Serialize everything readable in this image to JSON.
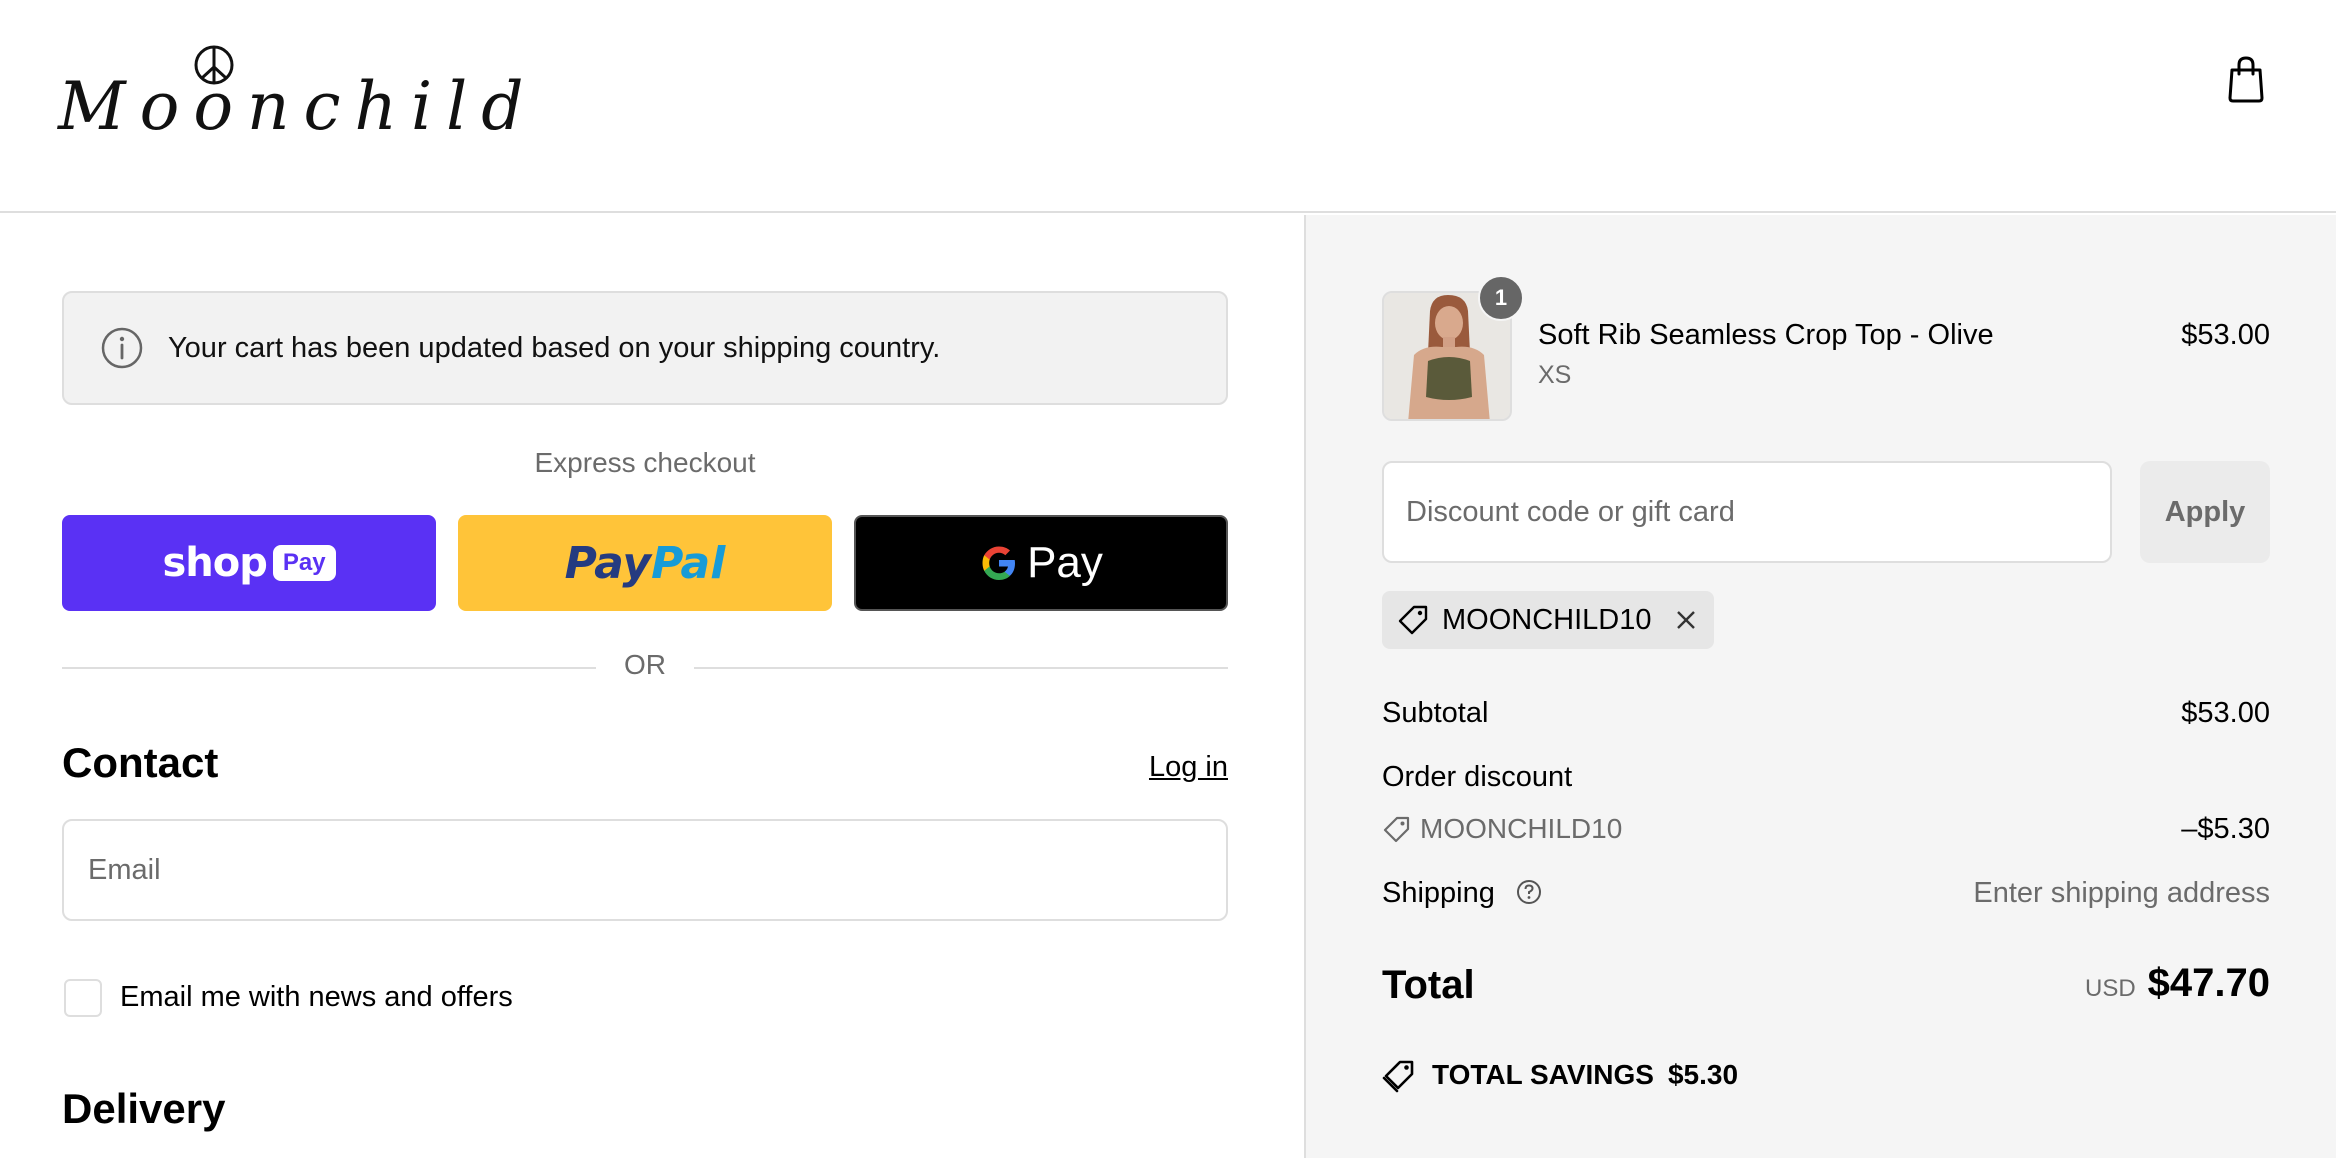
{
  "brand": {
    "name": "Moonchild",
    "logo_icon": "peace-sign-icon"
  },
  "header": {
    "cart_icon": "shopping-bag-icon"
  },
  "notice": {
    "icon": "info-icon",
    "text": "Your cart has been updated based on your shipping country."
  },
  "express": {
    "label": "Express checkout",
    "buttons": [
      {
        "name": "Shop Pay",
        "word": "shop",
        "pill": "Pay",
        "color": "#5a31f4"
      },
      {
        "name": "PayPal",
        "part1": "Pay",
        "part2": "Pal",
        "color": "#ffc439"
      },
      {
        "name": "Google Pay",
        "text": "Pay",
        "color": "#000000"
      }
    ],
    "or": "OR"
  },
  "contact": {
    "title": "Contact",
    "login": "Log in",
    "email_placeholder": "Email",
    "newsletter_label": "Email me with news and offers"
  },
  "delivery": {
    "title": "Delivery"
  },
  "order": {
    "item": {
      "name": "Soft Rib Seamless Crop Top - Olive",
      "variant": "XS",
      "price": "$53.00",
      "quantity": "1"
    },
    "discount_placeholder": "Discount code or gift card",
    "apply_label": "Apply",
    "applied_code": "MOONCHILD10",
    "subtotal_label": "Subtotal",
    "subtotal_value": "$53.00",
    "order_discount_label": "Order discount",
    "discount_code": "MOONCHILD10",
    "discount_value": "–$5.30",
    "shipping_label": "Shipping",
    "shipping_value": "Enter shipping address",
    "total_label": "Total",
    "currency": "USD",
    "total_value": "$47.70",
    "savings_label": "TOTAL SAVINGS",
    "savings_value": "$5.30"
  },
  "colors": {
    "accent": "#5a31f4",
    "border": "#dedede",
    "muted": "#6b6b6b",
    "sidebar_bg": "#f5f5f5"
  }
}
